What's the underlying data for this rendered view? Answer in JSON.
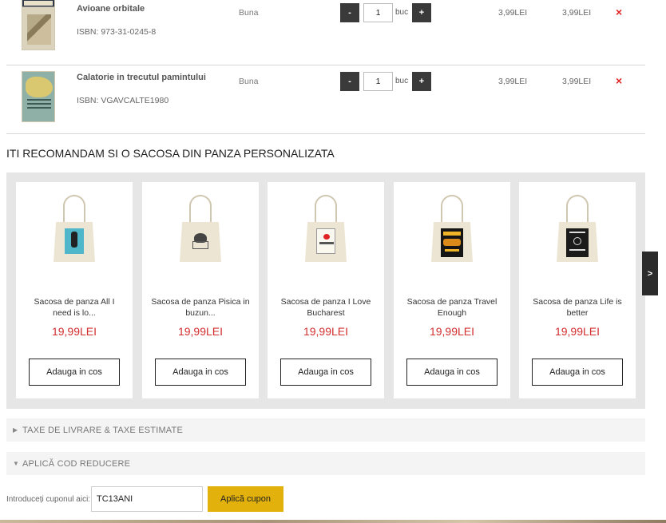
{
  "cart": {
    "qty_unit": "buc",
    "minus_label": "-",
    "plus_label": "+",
    "remove_icon": "×",
    "items": [
      {
        "title": "Avioane orbitale",
        "isbn": "ISBN: 973-31-0245-8",
        "condition": "Buna",
        "qty": "1",
        "price": "3,99LEI",
        "total": "3,99LEI"
      },
      {
        "title": "Calatorie in trecutul pamintului",
        "isbn": "ISBN: VGAVCALTE1980",
        "condition": "Buna",
        "qty": "1",
        "price": "3,99LEI",
        "total": "3,99LEI"
      }
    ]
  },
  "recommend": {
    "title": "ITI RECOMANDAM SI O SACOSA DIN PANZA PERSONALIZATA",
    "button_label": "Adauga in cos",
    "next_label": ">",
    "products": [
      {
        "name": "Sacosa de panza All I need is lo...",
        "price": "19,99LEI"
      },
      {
        "name": "Sacosa de panza Pisica in buzun...",
        "price": "19,99LEI"
      },
      {
        "name": "Sacosa de panza I Love Bucharest",
        "price": "19,99LEI"
      },
      {
        "name": "Sacosa de panza Travel Enough",
        "price": "19,99LEI"
      },
      {
        "name": "Sacosa de panza Life is better",
        "price": "19,99LEI"
      }
    ]
  },
  "shipping": {
    "label": "TAXE DE LIVRARE & TAXE ESTIMATE",
    "caret": "▶"
  },
  "discount": {
    "label": "APLICĂ COD REDUCERE",
    "caret": "▼"
  },
  "coupon": {
    "label": "Introduceți cuponul aici:",
    "value": "TC13ANI",
    "button": "Aplică cupon"
  },
  "colors": {
    "accent": "#e2b10b",
    "price": "#d32f2f",
    "remove": "#e02424"
  }
}
